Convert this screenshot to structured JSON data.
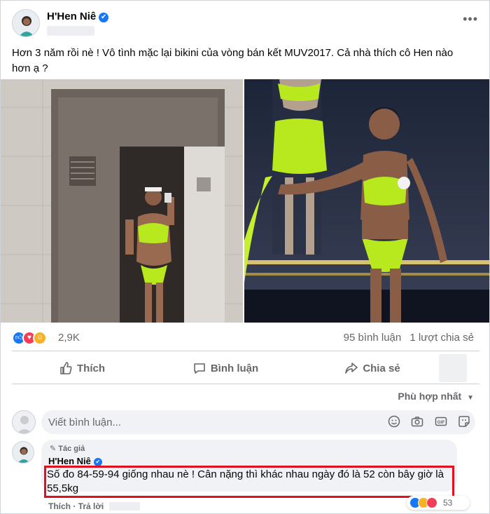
{
  "post": {
    "author": "H'Hen Niê",
    "verified_mark": "✔",
    "more_label": "•••",
    "text": "Hơn 3 năm rồi nè ! Vô tình mặc lại bikini của vòng bán kết MUV2017. Cả nhà thích cô Hen nào hơn ạ ?"
  },
  "reactions": {
    "count": "2,9K",
    "comments": "95 bình luận",
    "shares": "1 lượt chia sẻ",
    "icons": [
      "like-icon",
      "love-icon",
      "care-icon"
    ]
  },
  "actions": {
    "like": "Thích",
    "comment": "Bình luận",
    "share": "Chia sẻ"
  },
  "sort_label": "Phù hợp nhất",
  "composer": {
    "placeholder": "Viết bình luận..."
  },
  "comment": {
    "tag": "Tác giả",
    "author": "H'Hen Niê",
    "text": "Số đo 84-59-94 giống nhau nè ! Cân nặng thì khác nhau ngày đó là 52 còn bây giờ là 55,5kg",
    "like": "Thích",
    "reply": "Trả lời",
    "reaction_count": "53"
  },
  "colors": {
    "accent": "#1877f2",
    "highlight_box": "#e01020",
    "bikini": "#b8e81e"
  }
}
